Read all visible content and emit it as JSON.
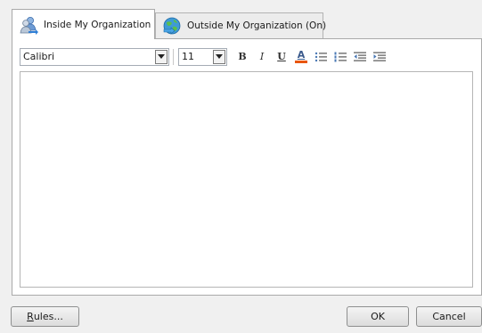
{
  "tabs": {
    "inside_label": "Inside My Organization",
    "outside_label": "Outside My Organization (On)"
  },
  "toolbar": {
    "font_value": "Calibri",
    "size_value": "11",
    "bold_glyph": "B",
    "italic_glyph": "I",
    "underline_glyph": "U",
    "font_color_glyph": "A",
    "font_color": "#e8560f"
  },
  "editor": {
    "content": ""
  },
  "buttons": {
    "rules_mnemonic": "R",
    "rules_rest": "ules...",
    "ok_label": "OK",
    "cancel_label": "Cancel"
  },
  "icons": {
    "inside_tab": "people-icon",
    "outside_tab": "globe-icon",
    "bullets": "bullet-list-icon",
    "numbering": "numbered-list-icon",
    "outdent": "decrease-indent-icon",
    "indent": "increase-indent-icon"
  }
}
